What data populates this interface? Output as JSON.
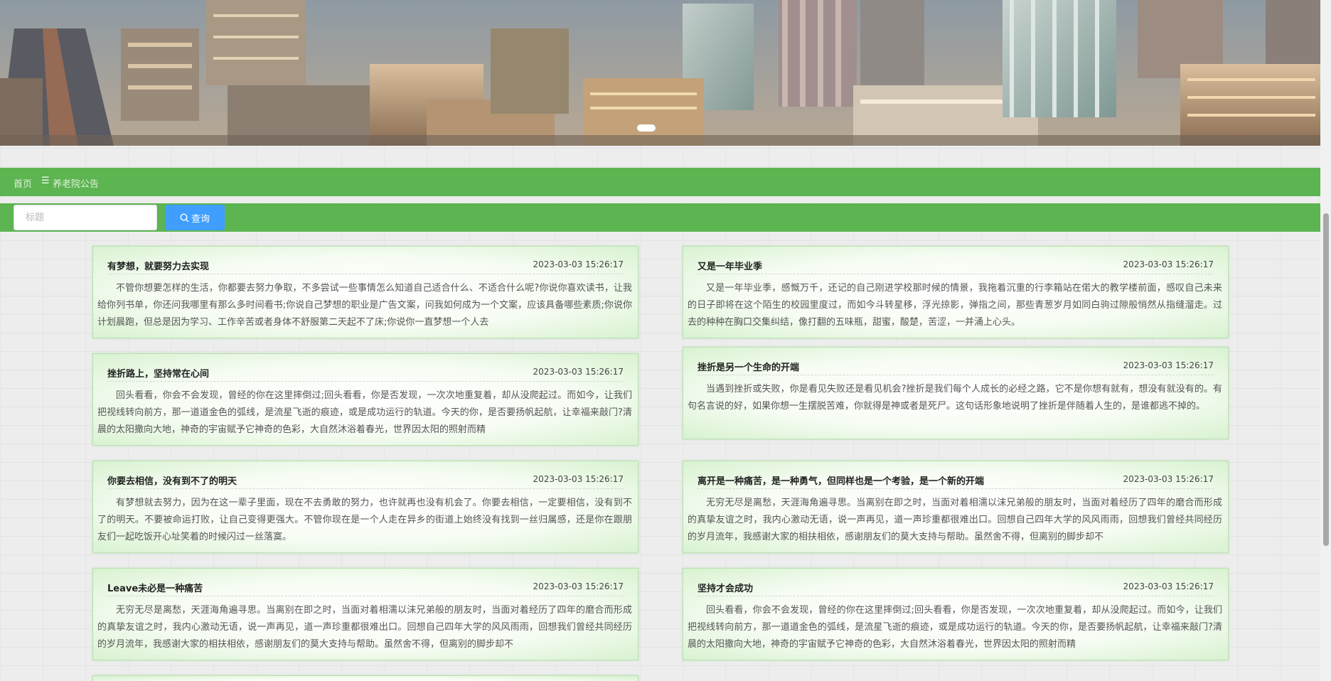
{
  "banner": {
    "alt": "city skyline banner"
  },
  "breadcrumb": {
    "home": "首页",
    "separator": "☰",
    "current": "养老院公告"
  },
  "search": {
    "placeholder": "标题",
    "value": "",
    "button_label": "查询",
    "button_icon": "search-icon"
  },
  "colors": {
    "bar_green": "#5cb550",
    "button_blue": "#409eff",
    "card_border": "#b9e3b0"
  },
  "cards": [
    {
      "title": "有梦想，就要努力去实现",
      "time": "2023-03-03 15:26:17",
      "body": "不管你想要怎样的生活，你都要去努力争取，不多尝试一些事情怎么知道自己适合什么、不适合什么呢?你说你喜欢读书，让我给你列书单，你还问我哪里有那么多时间看书;你说自己梦想的职业是广告文案，问我如何成为一个文案，应该具备哪些素质;你说你计划晨跑，但总是因为学习、工作辛苦或者身体不舒服第二天起不了床;你说你一直梦想一个人去"
    },
    {
      "title": "又是一年毕业季",
      "time": "2023-03-03 15:26:17",
      "body": "又是一年毕业季，感慨万千，还记的自己刚进学校那时候的情景，我拖着沉重的行李箱站在偌大的教学楼前面，感叹自己未来的日子即将在这个陌生的校园里度过，而如今斗转星移，浮光掠影，弹指之间，那些青葱岁月如同白驹过隙般悄然从指缝溜走。过去的种种在胸口交集纠结，像打翻的五味瓶，甜蜜，酸楚，苦涩，一并涌上心头。"
    },
    {
      "title": "挫折路上，坚持常在心间",
      "time": "2023-03-03 15:26:17",
      "body": "回头看看，你会不会发现，曾经的你在这里摔倒过;回头看看，你是否发现，一次次地重复着，却从没爬起过。而如今，让我们把视线转向前方，那一道道金色的弧线，是流星飞逝的痕迹，或是成功运行的轨道。今天的你，是否要扬帆起航，让幸福来敲门?清晨的太阳撒向大地，神奇的宇宙赋予它神奇的色彩，大自然沐浴着春光，世界因太阳的照射而精"
    },
    {
      "title": "挫折是另一个生命的开端",
      "time": "2023-03-03 15:26:17",
      "body": "当遇到挫折或失败，你是看见失败还是看见机会?挫折是我们每个人成长的必经之路，它不是你想有就有，想没有就没有的。有句名言说的好，如果你想一生摆脱苦难，你就得是神或者是死尸。这句话形象地说明了挫折是伴随着人生的，是谁都逃不掉的。"
    },
    {
      "title": "你要去相信，没有到不了的明天",
      "time": "2023-03-03 15:26:17",
      "body": "有梦想就去努力，因为在这一辈子里面，现在不去勇敢的努力，也许就再也没有机会了。你要去相信，一定要相信，没有到不了的明天。不要被命运打败，让自己变得更强大。不管你现在是一个人走在异乡的街道上始终没有找到一丝归属感，还是你在跟朋友们一起吃饭开心址笑着的时候闪过一丝落寞。"
    },
    {
      "title": "离开是一种痛苦，是一种勇气，但同样也是一个考验，是一个新的开端",
      "time": "2023-03-03 15:26:17",
      "body": "无穷无尽是离愁，天涯海角遍寻思。当离别在即之时，当面对着相濡以沫兄弟般的朋友时，当面对着经历了四年的磨合而形成的真挚友谊之时，我内心激动无语，说一声再见，道一声珍重都很难出口。回想自己四年大学的风风雨雨，回想我们曾经共同经历的岁月流年，我感谢大家的相扶相依，感谢朋友们的莫大支持与帮助。虽然舍不得，但离别的脚步却不"
    },
    {
      "title": "Leave未必是一种痛苦",
      "time": "2023-03-03 15:26:17",
      "body": "无穷无尽是离愁，天涯海角遍寻思。当离别在即之时，当面对着相濡以沫兄弟般的朋友时，当面对着经历了四年的磨合而形成的真挚友谊之时，我内心激动无语，说一声再见，道一声珍重都很难出口。回想自己四年大学的风风雨雨，回想我们曾经共同经历的岁月流年，我感谢大家的相扶相依，感谢朋友们的莫大支持与帮助。虽然舍不得，但离别的脚步却不"
    },
    {
      "title": "坚持才会成功",
      "time": "2023-03-03 15:26:17",
      "body": "回头看看，你会不会发现，曾经的你在这里摔倒过;回头看看，你是否发现，一次次地重复着，却从没爬起过。而如今，让我们把视线转向前方，那一道道金色的弧线，是流星飞逝的痕迹，或是成功运行的轨道。今天的你，是否要扬帆起航，让幸福来敲门?清晨的太阳撒向大地，神奇的宇宙赋予它神奇的色彩，大自然沐浴着春光，世界因太阳的照射而精"
    }
  ]
}
